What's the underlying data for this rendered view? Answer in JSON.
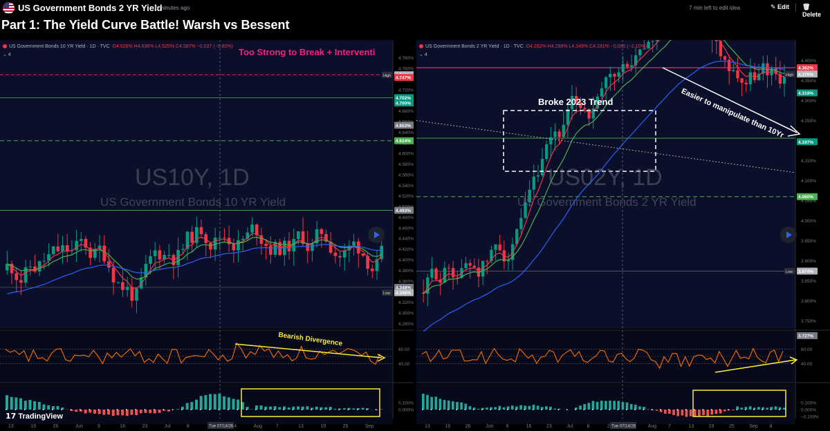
{
  "header": {
    "title": "US Government Bonds 2 YR Yield",
    "time_ago": "6 minutes ago",
    "edit_remaining": "7 min left to edit idea",
    "edit_label": "Edit",
    "delete_label": "Delete",
    "idea_title": "Part 1: The Yield Curve Battle! Warsh vs Bessent"
  },
  "left_chart": {
    "legend_title": "US Government Bonds 10 YR Yield · 1D · TVC",
    "legend_ohlc": "O4.626% H4.636% L4.525% C4.587% −0.037 (−0.80%)",
    "collapse": "⌄ 4",
    "watermark": "US10Y, 1D",
    "watermark_sub": "US Government Bonds 10 YR Yield",
    "annotation_top": "Too Strong to Break + Interventi",
    "annotation_div": "Bearish Divergence",
    "y_ticks": [
      "4.780%",
      "4.760%",
      "4.740%",
      "4.720%",
      "4.700%",
      "4.680%",
      "4.660%",
      "4.640%",
      "4.620%",
      "4.600%",
      "4.580%",
      "4.560%",
      "4.540%",
      "4.520%",
      "4.500%",
      "4.480%",
      "4.460%",
      "4.440%",
      "4.420%",
      "4.400%",
      "4.380%",
      "4.360%",
      "4.340%",
      "4.320%",
      "4.300%",
      "4.280%"
    ],
    "y_range": [
      4.27,
      4.79
    ],
    "price_tags": [
      {
        "label": "High",
        "value": "4.748%",
        "y": 4.748,
        "color": "#b2b5be"
      },
      {
        "label": "",
        "value": "4.747%",
        "y": 4.743,
        "color": "#f23645"
      },
      {
        "label": "",
        "value": "4.702%",
        "y": 4.705,
        "color": "#089981"
      },
      {
        "label": "",
        "value": "4.700%",
        "y": 4.695,
        "color": "#089981"
      },
      {
        "label": "",
        "value": "4.653%",
        "y": 4.653,
        "color": "#787b86"
      },
      {
        "label": "",
        "value": "4.624%",
        "y": 4.624,
        "color": "#4caf50"
      },
      {
        "label": "",
        "value": "4.493%",
        "y": 4.493,
        "color": "#787b86"
      },
      {
        "label": "",
        "value": "4.348%",
        "y": 4.348,
        "color": "#787b86"
      },
      {
        "label": "Low",
        "value": "4.346%",
        "y": 4.338,
        "color": "#b2b5be"
      }
    ],
    "x_ticks": [
      "13",
      "19",
      "26",
      "Jun",
      "9",
      "16",
      "23",
      "Jul",
      "8",
      "20",
      "24",
      "Aug",
      "7",
      "13",
      "19",
      "25",
      "Sep"
    ],
    "crosshair_date": "Tue 07/14/26",
    "rsi_ticks": [
      "60.00",
      "40.00"
    ],
    "macd_ticks": [
      "0.100%",
      "0.000%"
    ]
  },
  "right_chart": {
    "legend_title": "US Government Bonds 2 YR Yield · 1D · TVC",
    "legend_ohlc": "O4.282% H4.298% L4.149% C4.191% −0.090 (−2.10%)",
    "collapse": "⌄ 4",
    "watermark": "US02Y, 1D",
    "watermark_sub": "US Government Bonds 2 YR Yield",
    "annotation_box": "Broke 2023 Trend",
    "annotation_arrow": "Easier to manipulate than 10Yr",
    "y_ticks": [
      "4.400%",
      "4.350%",
      "4.300%",
      "4.250%",
      "4.200%",
      "4.150%",
      "4.100%",
      "4.050%",
      "4.000%",
      "3.950%",
      "3.900%",
      "3.850%",
      "3.800%",
      "3.750%"
    ],
    "y_range": [
      3.73,
      4.42
    ],
    "price_tags": [
      {
        "label": "",
        "value": "4.382%",
        "y": 4.382,
        "color": "#f23645"
      },
      {
        "label": "High",
        "value": "4.370%",
        "y": 4.366,
        "color": "#b2b5be"
      },
      {
        "label": "",
        "value": "4.319%",
        "y": 4.319,
        "color": "#089981"
      },
      {
        "label": "",
        "value": "4.197%",
        "y": 4.197,
        "color": "#089981"
      },
      {
        "label": "",
        "value": "4.060%",
        "y": 4.06,
        "color": "#4caf50"
      },
      {
        "label": "Low",
        "value": "3.874%",
        "y": 3.874,
        "color": "#b2b5be"
      }
    ],
    "x_ticks": [
      "13",
      "19",
      "26",
      "Jun",
      "9",
      "16",
      "23",
      "Jul",
      "8",
      "20",
      "24",
      "Aug",
      "7",
      "13",
      "19",
      "25",
      "Sep",
      "8"
    ],
    "crosshair_date": "Tue 07/14/26",
    "rsi_value": "3.727%",
    "rsi_ticks": [
      "60.00",
      "40.00"
    ],
    "macd_ticks": [
      "0.100%",
      "0.000%",
      "−0.100%"
    ]
  },
  "footer": {
    "logo": "TradingView"
  },
  "colors": {
    "bull": "#089981",
    "bear": "#f23645",
    "ema_red": "#f23645",
    "ema_green": "#4caf50",
    "ema_blue": "#2962ff",
    "rsi": "#ff6d00",
    "annotation_yellow": "#ffeb3b"
  }
}
